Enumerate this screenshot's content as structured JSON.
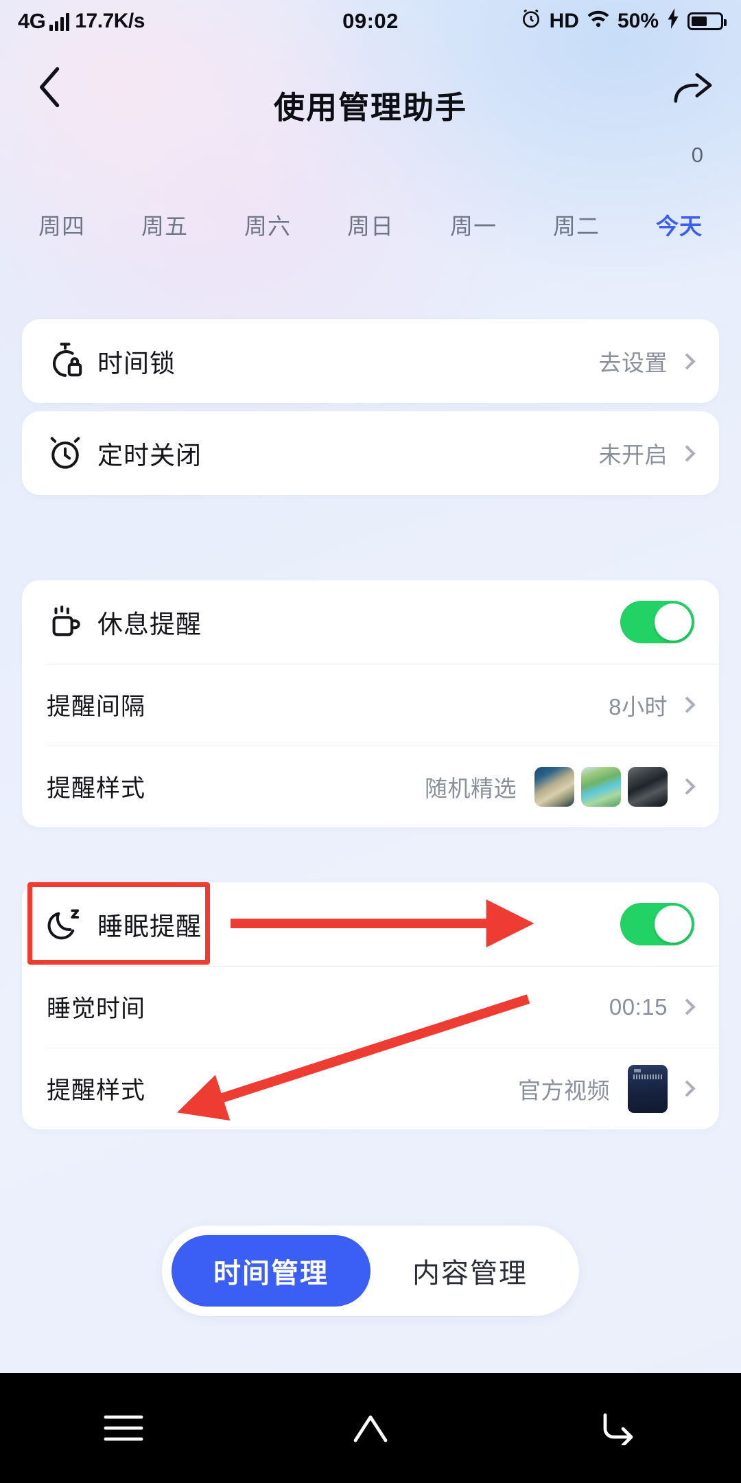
{
  "status_bar": {
    "network_type": "4G",
    "net_speed": "17.7K/s",
    "time": "09:02",
    "hd_label": "HD",
    "battery_percent": "50%"
  },
  "header": {
    "title": "使用管理助手",
    "counter": "0"
  },
  "day_tabs": [
    {
      "label": "周四",
      "active": false
    },
    {
      "label": "周五",
      "active": false
    },
    {
      "label": "周六",
      "active": false
    },
    {
      "label": "周日",
      "active": false
    },
    {
      "label": "周一",
      "active": false
    },
    {
      "label": "周二",
      "active": false
    },
    {
      "label": "今天",
      "active": true
    }
  ],
  "cards": {
    "time_lock": {
      "label": "时间锁",
      "value": "去设置"
    },
    "timed_shutdown": {
      "label": "定时关闭",
      "value": "未开启"
    },
    "rest_reminder": {
      "label": "休息提醒",
      "toggle_on": true,
      "interval_label": "提醒间隔",
      "interval_value": "8小时",
      "style_label": "提醒样式",
      "style_value": "随机精选"
    },
    "sleep_reminder": {
      "label": "睡眠提醒",
      "toggle_on": true,
      "bedtime_label": "睡觉时间",
      "bedtime_value": "00:15",
      "style_label": "提醒样式",
      "style_value": "官方视频"
    }
  },
  "segmented": {
    "time_management": "时间管理",
    "content_management": "内容管理"
  },
  "colors": {
    "accent_blue": "#3B5EF5",
    "toggle_green": "#22D264",
    "annotation_red": "#EF3C32",
    "muted_text": "#8A8F9C"
  }
}
